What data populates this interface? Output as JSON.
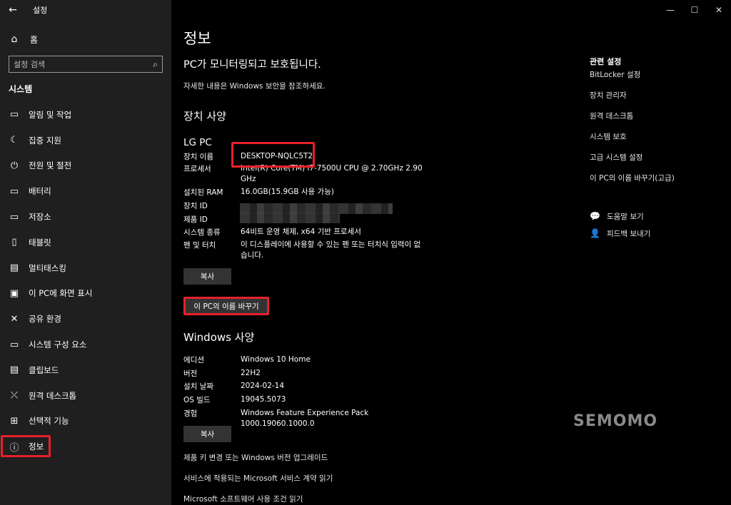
{
  "window": {
    "title": "설정",
    "minimize": "—",
    "maximize": "☐",
    "close": "✕"
  },
  "sidebar": {
    "home": "홈",
    "search_placeholder": "설정 검색",
    "section": "시스템",
    "items": [
      {
        "label": "알림 및 작업",
        "icon": "notification-icon",
        "glyph": "▭"
      },
      {
        "label": "집중 지원",
        "icon": "moon-icon",
        "glyph": "☾"
      },
      {
        "label": "전원 및 절전",
        "icon": "power-icon",
        "glyph": "⏻"
      },
      {
        "label": "배터리",
        "icon": "battery-icon",
        "glyph": "▭"
      },
      {
        "label": "저장소",
        "icon": "storage-icon",
        "glyph": "▭"
      },
      {
        "label": "태블릿",
        "icon": "tablet-icon",
        "glyph": "▯"
      },
      {
        "label": "멀티태스킹",
        "icon": "multitask-icon",
        "glyph": "▤"
      },
      {
        "label": "이 PC에 화면 표시",
        "icon": "project-icon",
        "glyph": "▣"
      },
      {
        "label": "공유 환경",
        "icon": "shared-icon",
        "glyph": "✕"
      },
      {
        "label": "시스템 구성 요소",
        "icon": "components-icon",
        "glyph": "▭"
      },
      {
        "label": "클립보드",
        "icon": "clipboard-icon",
        "glyph": "▤"
      },
      {
        "label": "원격 데스크톱",
        "icon": "remote-icon",
        "glyph": "⤬"
      },
      {
        "label": "선택적 기능",
        "icon": "features-icon",
        "glyph": "⊞"
      },
      {
        "label": "정보",
        "icon": "info-icon",
        "glyph": "ⓘ"
      }
    ]
  },
  "main": {
    "title": "정보",
    "protect": "PC가 모니터링되고 보호됩니다.",
    "protect_sub": "자세한 내용은 Windows 보안을 참조하세요.",
    "device_heading": "장치 사양",
    "pc_name": "LG PC",
    "device_specs": [
      {
        "k": "장치 이름",
        "v": "DESKTOP-NQLC5T2"
      },
      {
        "k": "프로세서",
        "v": "Intel(R) Core(TM) i7-7500U CPU @ 2.70GHz   2.90 GHz"
      },
      {
        "k": "설치된 RAM",
        "v": "16.0GB(15.9GB 사용 가능)"
      },
      {
        "k": "장치 ID",
        "v": ""
      },
      {
        "k": "제품 ID",
        "v": ""
      },
      {
        "k": "시스템 종류",
        "v": "64비트 운영 체제, x64 기반 프로세서"
      },
      {
        "k": "펜 및 터치",
        "v": "이 디스플레이에 사용할 수 있는 펜 또는 터치식 입력이 없습니다."
      }
    ],
    "copy": "복사",
    "rename": "이 PC의 이름 바꾸기",
    "windows_heading": "Windows 사양",
    "windows_specs": [
      {
        "k": "에디션",
        "v": "Windows 10 Home"
      },
      {
        "k": "버전",
        "v": "22H2"
      },
      {
        "k": "설치 날짜",
        "v": "2024-02-14"
      },
      {
        "k": "OS 빌드",
        "v": "19045.5073"
      },
      {
        "k": "경험",
        "v": "Windows Feature Experience Pack 1000.19060.1000.0"
      }
    ],
    "links": [
      "제품 키 변경 또는 Windows 버전 업그레이드",
      "서비스에 적용되는 Microsoft 서비스 계약 읽기",
      "Microsoft 소프트웨어 사용 조건 읽기"
    ]
  },
  "related": {
    "title": "관련 설정",
    "links": [
      "BitLocker 설정",
      "장치 관리자",
      "원격 데스크톱",
      "시스템 보호",
      "고급 시스템 설정",
      "이 PC의 이름 바꾸기(고급)"
    ],
    "help": "도움말 보기",
    "feedback": "피드백 보내기"
  },
  "watermark": "SEMOMO",
  "accent": "#e8202a"
}
